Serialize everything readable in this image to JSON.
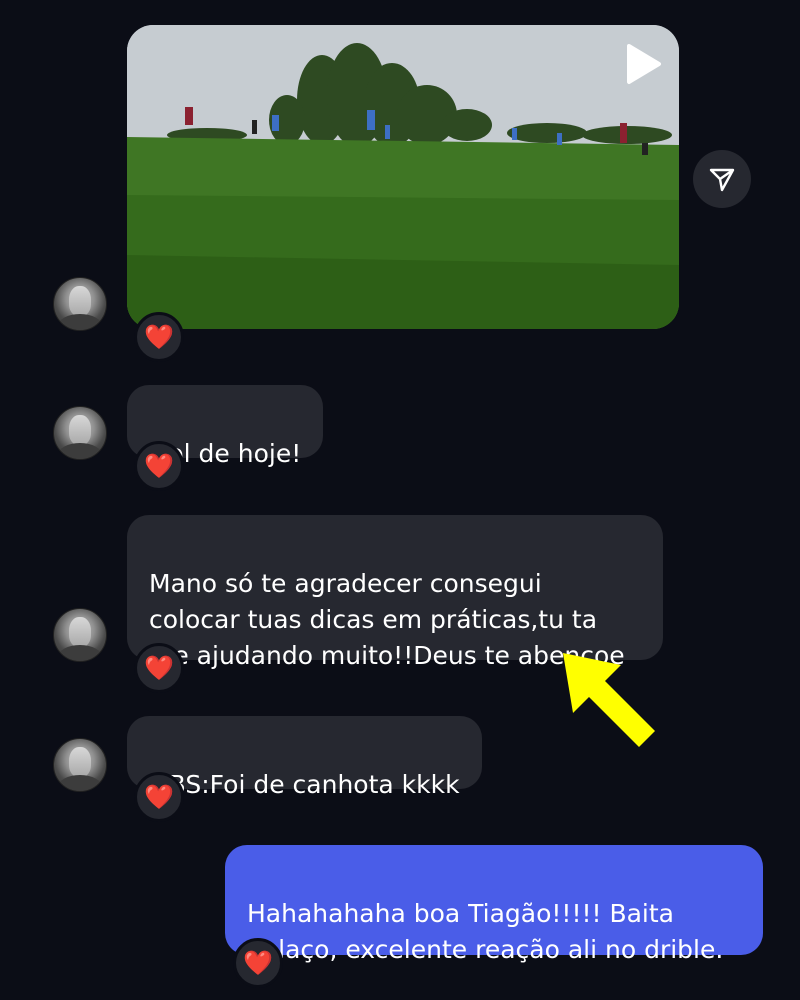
{
  "messages": [
    {
      "id": "video",
      "type": "video",
      "reaction": "❤️"
    },
    {
      "id": "m1",
      "type": "text",
      "text": "Gol de hoje!",
      "reaction": "❤️"
    },
    {
      "id": "m2",
      "type": "text",
      "text": "Mano só te agradecer consegui\ncolocar tuas dicas em práticas,tu ta\nme ajudando muito!!Deus te abençoe",
      "reaction": "❤️"
    },
    {
      "id": "m3",
      "type": "text",
      "text": "OBS:Foi de canhota kkkk",
      "reaction": "❤️"
    },
    {
      "id": "m4",
      "type": "text",
      "text": "Hahahahaha boa Tiagão!!!!! Baita\ngolaço, excelente reação ali no drible.",
      "reaction": "❤️",
      "sender": "me"
    }
  ],
  "icons": {
    "play": "play-icon",
    "share": "paper-plane-icon",
    "annotation": "yellow-arrow"
  },
  "colors": {
    "background": "#0b0d16",
    "received_bubble": "#262830",
    "sent_bubble": "#4a5de8",
    "annotation_arrow": "#ffff00"
  }
}
